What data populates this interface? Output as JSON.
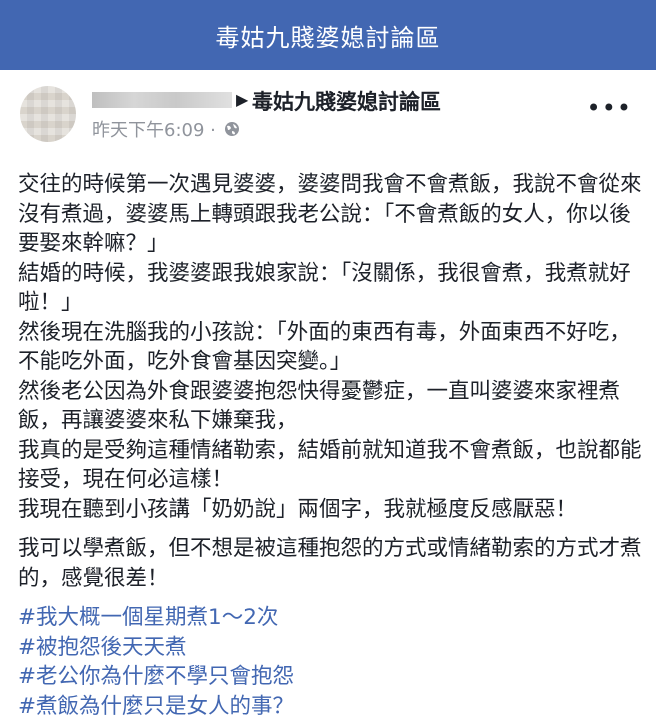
{
  "topbar": {
    "title": "毒姑九賤婆媳討論區"
  },
  "post": {
    "author_redacted": true,
    "group_name": "毒姑九賤婆媳討論區",
    "timestamp": "昨天下午6:09 ·",
    "paragraphs": [
      "交往的時候第一次遇見婆婆，婆婆問我會不會煮飯，我說不會從來沒有煮過，婆婆馬上轉頭跟我老公說：「不會煮飯的女人，你以後要娶來幹嘛？」",
      "結婚的時候，我婆婆跟我娘家說：「沒關係，我很會煮，我煮就好啦！」",
      "然後現在洗腦我的小孩說：「外面的東西有毒，外面東西不好吃，不能吃外面，吃外食會基因突變。」",
      "然後老公因為外食跟婆婆抱怨快得憂鬱症，一直叫婆婆來家裡煮飯，再讓婆婆來私下嫌棄我，",
      "我真的是受夠這種情緒勒索，結婚前就知道我不會煮飯，也說都能接受，現在何必這樣！",
      "我現在聽到小孩講「奶奶說」兩個字，我就極度反感厭惡！"
    ],
    "closing": "我可以學煮飯，但不想是被這種抱怨的方式或情緒勒索的方式才煮的，感覺很差！",
    "hashtags": [
      "#我大概一個星期煮1～2次",
      "#被抱怨後天天煮",
      "#老公你為什麼不學只會抱怨",
      "#煮飯為什麼只是女人的事？"
    ]
  },
  "icons": {
    "arrow": "right-arrow-icon",
    "globe": "globe-icon",
    "more": "more-options-icon"
  },
  "colors": {
    "topbar_bg": "#4267b2",
    "link": "#4267b2",
    "meta": "#90949c"
  }
}
